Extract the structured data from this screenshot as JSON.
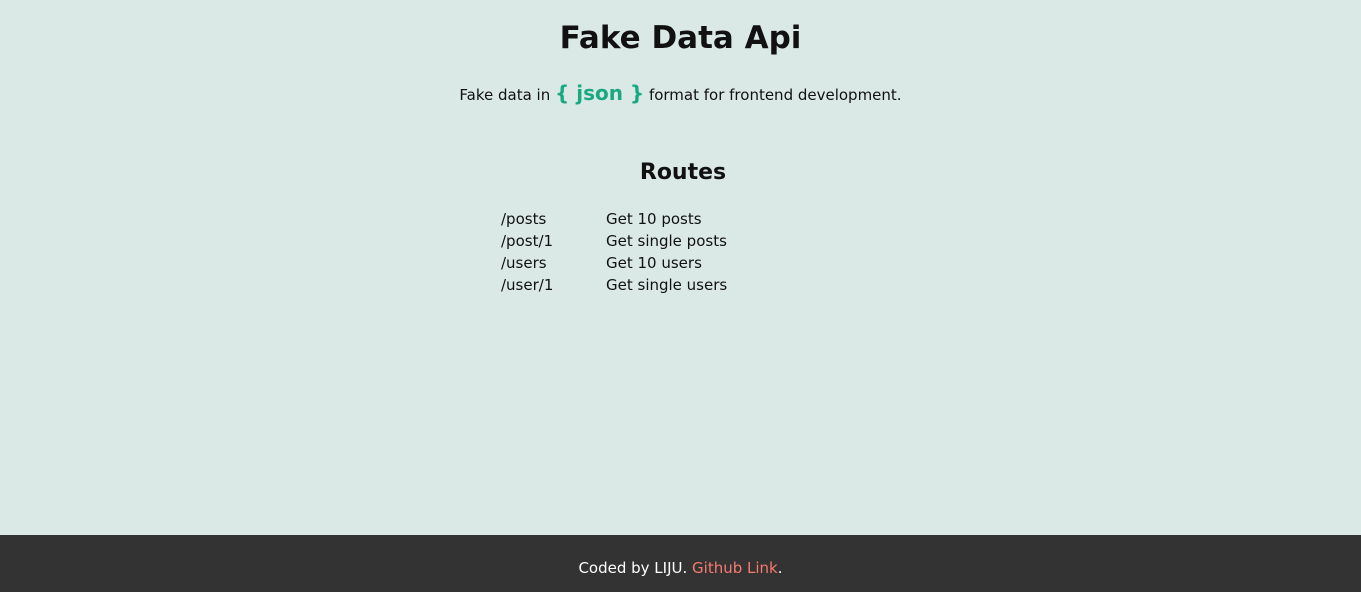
{
  "header": {
    "title": "Fake Data Api",
    "tagline_prefix": "Fake data in",
    "tagline_highlight": "{ json }",
    "tagline_suffix": "format for frontend development."
  },
  "routes": {
    "title": "Routes",
    "items": [
      {
        "path": "/posts",
        "description": "Get 10 posts"
      },
      {
        "path": "/post/1",
        "description": "Get single posts"
      },
      {
        "path": "/users",
        "description": "Get 10 users"
      },
      {
        "path": "/user/1",
        "description": "Get single users"
      }
    ]
  },
  "footer": {
    "text": "Coded by LIJU.",
    "link_label": "Github Link",
    "suffix": "."
  },
  "colors": {
    "background": "#dbe9e6",
    "accent": "#1aa883",
    "footer_background": "#333333",
    "footer_link": "#f77a70"
  }
}
